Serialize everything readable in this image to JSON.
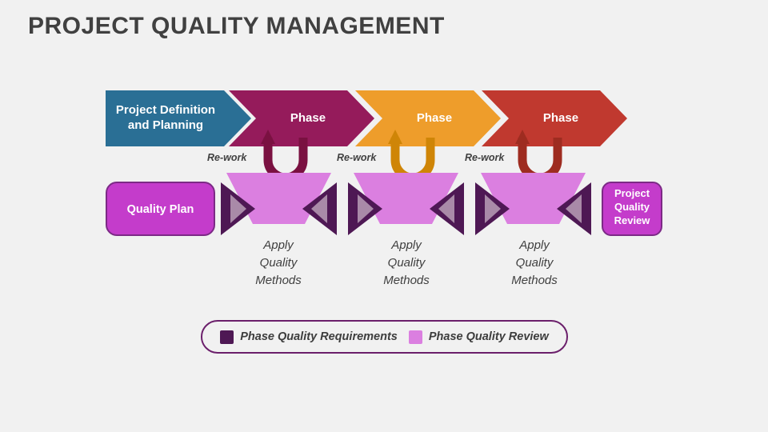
{
  "slide": {
    "title": "PROJECT QUALITY MANAGEMENT",
    "background_color": "#f1f1f1",
    "title_color": "#404040"
  },
  "process_flow": {
    "name": "phase-chevron-flow",
    "steps": [
      {
        "label": "Project Definition\nand Planning",
        "line1": "Project Definition",
        "line2": "and Planning",
        "color": "#2a6f95"
      },
      {
        "label": "Phase",
        "line1": "Phase",
        "line2": "",
        "color": "#951b5b"
      },
      {
        "label": "Phase",
        "line1": "Phase",
        "line2": "",
        "color": "#ee9d2b"
      },
      {
        "label": "Phase",
        "line1": "Phase",
        "line2": "",
        "color": "#c0392f"
      }
    ]
  },
  "rework_loops": [
    {
      "label": "Re-work",
      "color": "#7a1141"
    },
    {
      "label": "Re-work",
      "color": "#cf8507"
    },
    {
      "label": "Re-work",
      "color": "#9e2c20"
    }
  ],
  "quality_band": {
    "quality_plan": {
      "label": "Quality Plan",
      "fill": "#c43ccb",
      "stroke": "#7c2a86",
      "text_color": "#ffffff"
    },
    "review_box": {
      "line1": "Project",
      "line2": "Quality",
      "line3": "Review",
      "fill": "#c43ccb",
      "stroke": "#7c2a86",
      "text_color": "#ffffff"
    },
    "review_fill": "#db7fe0",
    "requirement_triangle_outer": "#4e1854",
    "requirement_triangle_inner": "#a98aa8",
    "apply_blocks": [
      {
        "line1": "Apply",
        "line2": "Quality",
        "line3": "Methods"
      },
      {
        "line1": "Apply",
        "line2": "Quality",
        "line3": "Methods"
      },
      {
        "line1": "Apply",
        "line2": "Quality",
        "line3": "Methods"
      }
    ]
  },
  "legend": {
    "name": "diagram-legend",
    "border_color": "#6b1f6b",
    "items": [
      {
        "label": "Phase Quality Requirements",
        "color": "#4e1854"
      },
      {
        "label": "Phase Quality Review",
        "color": "#db7fe0"
      }
    ]
  }
}
